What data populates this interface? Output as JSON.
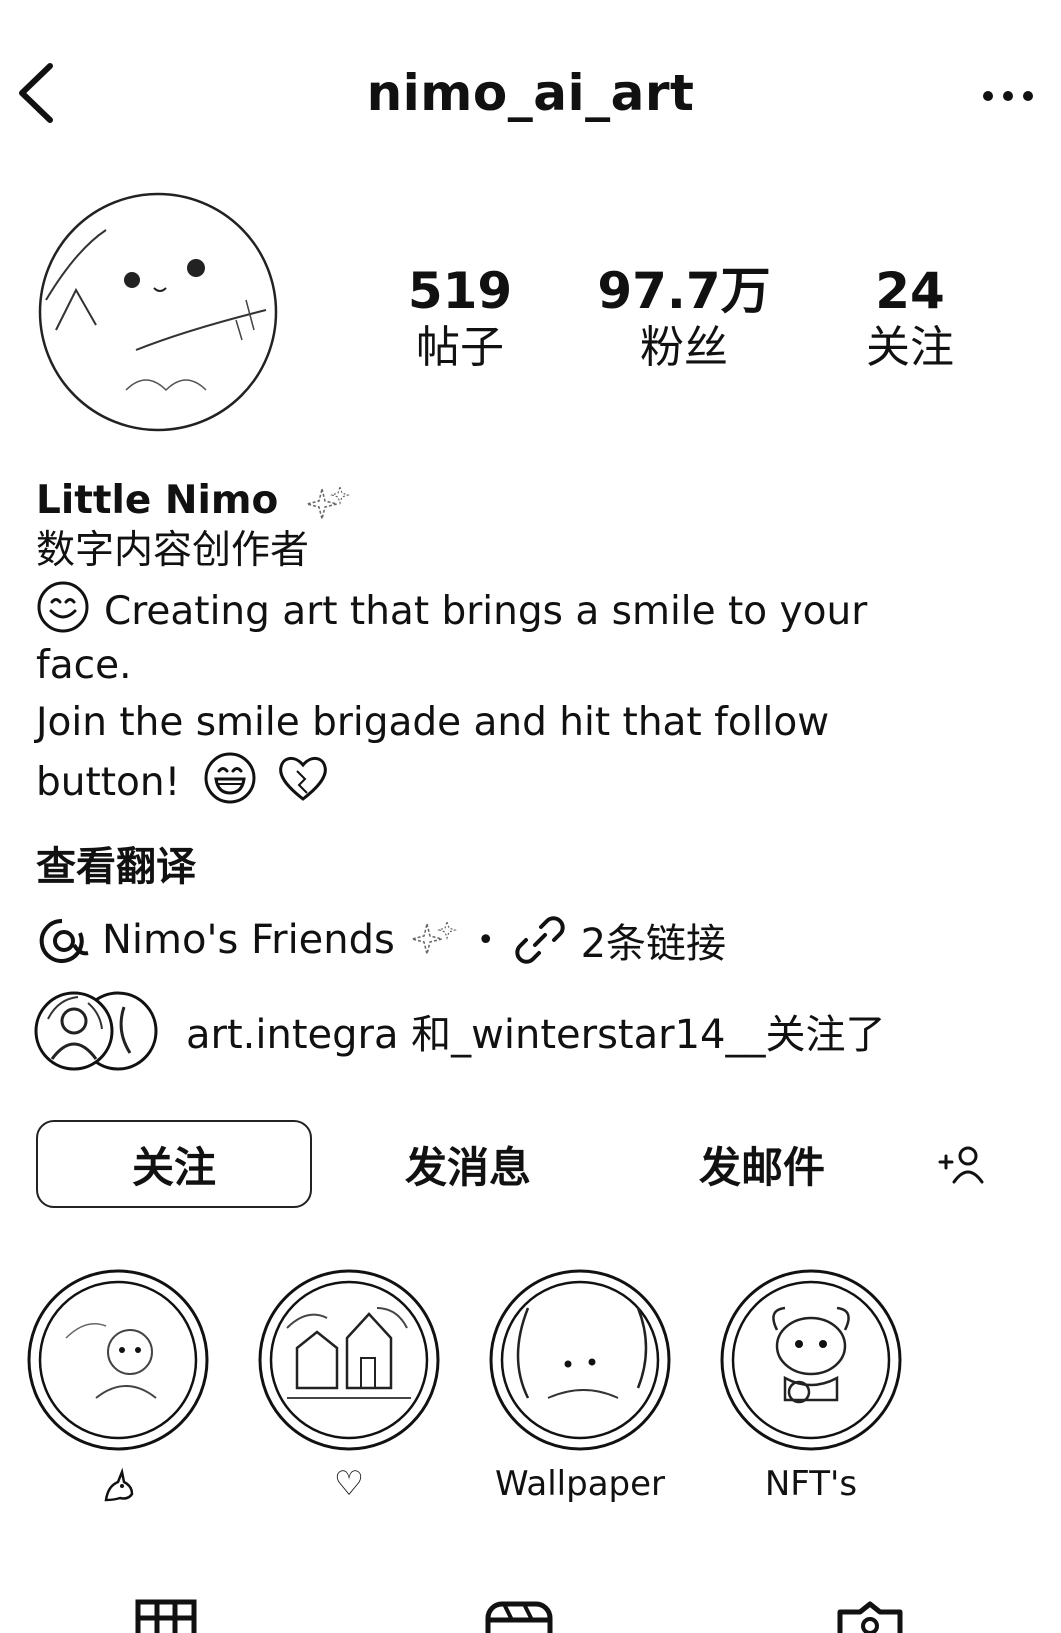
{
  "header": {
    "username": "nimo_ai_art"
  },
  "stats": [
    {
      "value": "519",
      "label": "帖子"
    },
    {
      "value": "97.7万",
      "label": "粉丝"
    },
    {
      "value": "24",
      "label": "关注"
    }
  ],
  "profile": {
    "name": "Little Nimo",
    "category": "数字内容创作者",
    "bio_line1": "Creating art that brings a smile to your",
    "bio_line2": "face.",
    "bio_line3": "Join the smile brigade and hit that follow",
    "bio_line4": "button!",
    "translate_label": "查看翻译"
  },
  "links": {
    "threads_name": "Nimo's Friends",
    "links_label": "2条链接"
  },
  "followed_by": {
    "text": "art.integra 和_winterstar14__关注了"
  },
  "actions": {
    "follow": "关注",
    "message": "发消息",
    "email": "发邮件"
  },
  "highlights": [
    {
      "label": "",
      "icon": "unicorn-icon"
    },
    {
      "label": "♡",
      "icon": "heart-outline-icon"
    },
    {
      "label": "Wallpaper",
      "icon": ""
    },
    {
      "label": "NFT's",
      "icon": ""
    }
  ],
  "bottom_tabs": [
    "grid-icon",
    "reels-icon",
    "tagged-icon"
  ]
}
